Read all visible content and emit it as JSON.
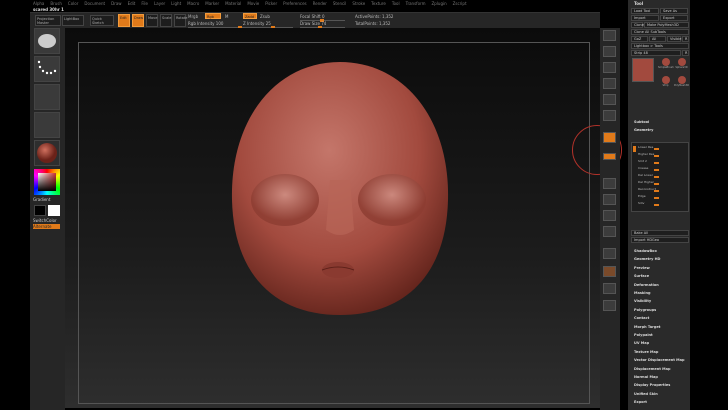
{
  "menu": [
    "Alpha",
    "Brush",
    "Color",
    "Document",
    "Draw",
    "Edit",
    "File",
    "Layer",
    "Light",
    "Macro",
    "Marker",
    "Material",
    "Movie",
    "Picker",
    "Preferences",
    "Render",
    "Stencil",
    "Stroke",
    "Texture",
    "Tool",
    "Transform",
    "Zplugin",
    "Zscript"
  ],
  "title": "scared 30hr 1",
  "shelf": {
    "projection_master": "Projection Master",
    "lightbox": "LightBox",
    "quick_sketch": "Quick Sketch",
    "edit": "Edit",
    "draw": "Draw",
    "move": "Move",
    "scale": "Scale",
    "rotate": "Rotate",
    "mrgb": "Mrgb",
    "rgb": "Rgb",
    "m": "M",
    "zadd": "Zadd",
    "zsub": "Zsub",
    "rgb_intensity": "Rgb Intensity 100",
    "z_intensity": "Z Intensity 25",
    "focal_shift": "Focal Shift 0",
    "draw_size": "Draw Size 74",
    "active_points": "ActivePoints: 1,352",
    "total_points": "TotalPoints: 1,352"
  },
  "left": {
    "gradient": "Gradient",
    "switch_color": "SwitchColor",
    "alternate": "Alternate"
  },
  "tool_panel": {
    "title": "Tool",
    "buttons": [
      "Load Tool",
      "Save As",
      "Import",
      "Export",
      "Clone",
      "Make PolyMesh3D",
      "Clone All SubTools",
      "GoZ",
      "All",
      "Visible",
      "R",
      "Lightbox > Tools",
      "Strip 48",
      "R"
    ],
    "tools": [
      "SimpleBrush",
      "Sphere3D",
      "Strip",
      "PolyMesh3D"
    ],
    "sections": [
      "Subtool",
      "Geometry"
    ],
    "subdiv_label": "SDiv 5",
    "sliders": [
      "Lower Res",
      "Higher Res",
      "Smt 2",
      "Crease",
      "Del Lower",
      "Del Higher",
      "Reconstruct",
      "Edge",
      "Sdiv"
    ],
    "bake_all": "Bake All",
    "import_hd": "Import HDGeo",
    "bottom_sections": [
      "ShadowBox",
      "Geometry HD",
      "Preview",
      "Surface",
      "Deformation",
      "Masking",
      "Visibility",
      "Polygroups",
      "Contact",
      "Morph Target",
      "Polypaint",
      "UV Map",
      "Texture Map",
      "Vector Displacement Map",
      "Displacement Map",
      "Normal Map",
      "Display Properties",
      "Unified Skin",
      "Export"
    ]
  },
  "colors": {
    "accent": "#e07a1a",
    "skin": "#a24a3e"
  }
}
